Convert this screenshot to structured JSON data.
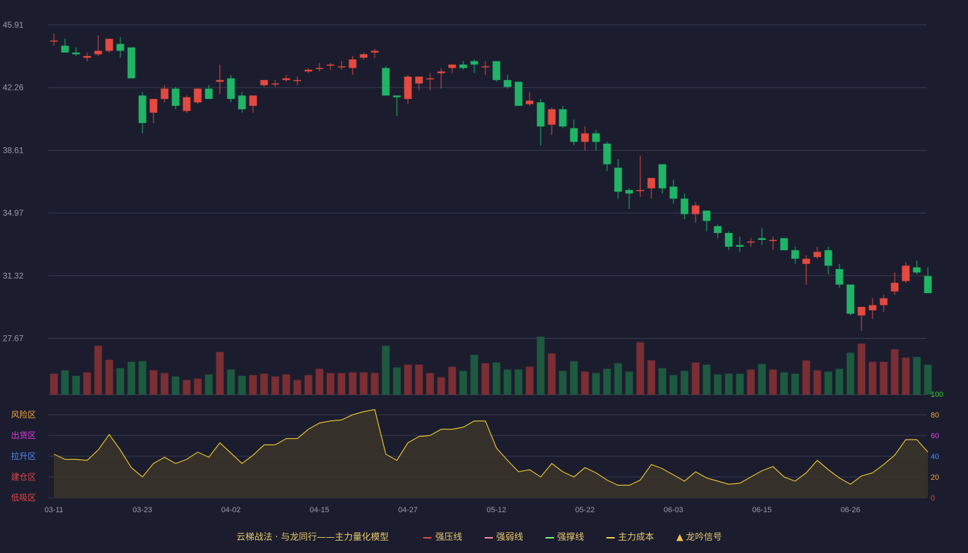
{
  "colors": {
    "background": "#1b1d2e",
    "up": "#e5493f",
    "down": "#1fb566",
    "up_vol": "#7b2e33",
    "down_vol": "#1d5a3f",
    "grid": "#3a3d52",
    "axis_text": "#9a9cab",
    "line": "#e8c32e",
    "area": "#3a3429"
  },
  "chart_data": [
    {
      "type": "candlestick",
      "title": "",
      "ylim": [
        24.02,
        45.91
      ],
      "y_ticks": [
        "45.91",
        "42.26",
        "38.61",
        "34.97",
        "31.32",
        "27.67"
      ],
      "x_ticks": [
        {
          "label": "03-11",
          "index": 0
        },
        {
          "label": "03-23",
          "index": 8
        },
        {
          "label": "04-02",
          "index": 16
        },
        {
          "label": "04-15",
          "index": 24
        },
        {
          "label": "04-27",
          "index": 32
        },
        {
          "label": "05-12",
          "index": 40
        },
        {
          "label": "05-22",
          "index": 48
        },
        {
          "label": "06-03",
          "index": 56
        },
        {
          "label": "06-15",
          "index": 64
        },
        {
          "label": "06-26",
          "index": 72
        }
      ],
      "ohlc": [
        [
          45.0,
          45.0,
          45.4,
          44.7
        ],
        [
          44.7,
          44.3,
          45.1,
          44.3
        ],
        [
          44.3,
          44.2,
          44.6,
          44.1
        ],
        [
          44.0,
          44.1,
          44.3,
          43.8
        ],
        [
          44.2,
          44.4,
          45.3,
          44.1
        ],
        [
          44.4,
          45.1,
          45.1,
          44.3
        ],
        [
          44.8,
          44.4,
          45.2,
          44.0
        ],
        [
          44.6,
          42.8,
          44.6,
          42.8
        ],
        [
          41.8,
          40.2,
          42.0,
          39.6
        ],
        [
          40.8,
          41.6,
          41.6,
          40.2
        ],
        [
          41.6,
          42.2,
          42.4,
          41.4
        ],
        [
          42.2,
          41.2,
          42.3,
          41.0
        ],
        [
          40.9,
          41.7,
          41.8,
          40.8
        ],
        [
          41.4,
          42.2,
          42.2,
          41.3
        ],
        [
          42.2,
          41.6,
          42.4,
          41.6
        ],
        [
          42.6,
          42.7,
          43.6,
          41.9
        ],
        [
          42.8,
          41.6,
          43.0,
          41.4
        ],
        [
          41.8,
          41.0,
          42.0,
          40.8
        ],
        [
          41.2,
          41.8,
          41.8,
          40.8
        ],
        [
          42.4,
          42.7,
          42.7,
          42.3
        ],
        [
          42.5,
          42.5,
          42.7,
          42.3
        ],
        [
          42.7,
          42.8,
          43.0,
          42.6
        ],
        [
          42.7,
          42.7,
          42.9,
          42.4
        ],
        [
          43.2,
          43.3,
          43.4,
          43.1
        ],
        [
          43.4,
          43.4,
          43.7,
          43.2
        ],
        [
          43.6,
          43.6,
          43.7,
          43.3
        ],
        [
          43.5,
          43.5,
          43.8,
          43.3
        ],
        [
          43.4,
          43.9,
          44.1,
          43.0
        ],
        [
          44.0,
          44.2,
          44.3,
          43.9
        ],
        [
          44.3,
          44.4,
          44.5,
          44.0
        ],
        [
          43.4,
          41.8,
          43.5,
          41.8
        ],
        [
          41.8,
          41.7,
          41.8,
          40.6
        ],
        [
          41.6,
          42.9,
          43.0,
          41.3
        ],
        [
          42.5,
          42.9,
          42.9,
          42.1
        ],
        [
          42.8,
          42.8,
          43.1,
          42.1
        ],
        [
          43.1,
          43.2,
          43.4,
          42.2
        ],
        [
          43.4,
          43.6,
          43.6,
          43.1
        ],
        [
          43.6,
          43.4,
          43.8,
          43.3
        ],
        [
          43.8,
          43.6,
          43.9,
          43.1
        ],
        [
          43.5,
          43.5,
          43.8,
          43.0
        ],
        [
          43.8,
          42.7,
          43.8,
          42.6
        ],
        [
          42.7,
          42.3,
          43.0,
          42.2
        ],
        [
          42.6,
          41.2,
          42.6,
          41.2
        ],
        [
          41.3,
          41.5,
          42.0,
          41.2
        ],
        [
          41.4,
          40.0,
          41.6,
          38.9
        ],
        [
          40.1,
          41.0,
          41.1,
          39.5
        ],
        [
          41.0,
          40.0,
          41.2,
          39.9
        ],
        [
          39.9,
          39.1,
          40.4,
          38.9
        ],
        [
          39.1,
          39.6,
          40.0,
          38.6
        ],
        [
          39.6,
          39.1,
          39.8,
          38.6
        ],
        [
          39.0,
          37.8,
          39.1,
          37.4
        ],
        [
          37.6,
          36.2,
          38.1,
          35.8
        ],
        [
          36.3,
          36.1,
          36.4,
          35.2
        ],
        [
          36.3,
          36.3,
          38.3,
          35.9
        ],
        [
          36.4,
          37.0,
          37.0,
          35.8
        ],
        [
          37.8,
          36.4,
          37.8,
          36.1
        ],
        [
          36.5,
          35.8,
          36.9,
          35.5
        ],
        [
          35.8,
          34.9,
          36.1,
          34.6
        ],
        [
          34.9,
          35.4,
          35.6,
          34.4
        ],
        [
          35.1,
          34.5,
          35.1,
          33.9
        ],
        [
          34.2,
          33.8,
          34.3,
          33.5
        ],
        [
          33.8,
          33.0,
          33.9,
          32.8
        ],
        [
          33.1,
          33.0,
          33.6,
          32.7
        ],
        [
          33.3,
          33.3,
          33.5,
          33.0
        ],
        [
          33.5,
          33.4,
          34.1,
          33.1
        ],
        [
          33.4,
          33.4,
          33.6,
          32.8
        ],
        [
          33.5,
          32.8,
          33.5,
          32.8
        ],
        [
          32.8,
          32.3,
          33.0,
          32.0
        ],
        [
          32.0,
          32.3,
          32.5,
          30.8
        ],
        [
          32.4,
          32.7,
          33.0,
          32.3
        ],
        [
          32.8,
          31.9,
          33.0,
          31.4
        ],
        [
          31.7,
          30.8,
          32.0,
          30.6
        ],
        [
          30.8,
          29.1,
          30.8,
          29.0
        ],
        [
          29.0,
          29.5,
          29.5,
          28.1
        ],
        [
          29.3,
          29.6,
          30.0,
          28.8
        ],
        [
          29.6,
          30.0,
          30.2,
          29.2
        ],
        [
          30.4,
          30.9,
          31.5,
          30.2
        ],
        [
          31.0,
          31.9,
          32.1,
          30.9
        ],
        [
          31.8,
          31.5,
          32.2,
          31.4
        ],
        [
          31.3,
          30.3,
          31.8,
          30.3
        ]
      ]
    },
    {
      "type": "bar",
      "title": "",
      "volume": [
        30,
        35,
        27,
        32,
        70,
        50,
        38,
        47,
        48,
        35,
        31,
        26,
        21,
        23,
        29,
        61,
        36,
        27,
        28,
        30,
        26,
        29,
        21,
        28,
        37,
        31,
        31,
        32,
        32,
        31,
        70,
        39,
        43,
        43,
        31,
        25,
        40,
        34,
        57,
        45,
        46,
        36,
        36,
        40,
        83,
        59,
        34,
        48,
        33,
        31,
        37,
        45,
        33,
        75,
        49,
        38,
        28,
        34,
        46,
        43,
        29,
        30,
        30,
        36,
        44,
        36,
        32,
        30,
        49,
        35,
        33,
        37,
        60,
        73,
        47,
        47,
        65,
        53,
        54,
        43
      ]
    },
    {
      "type": "area",
      "title": "",
      "ylim": [
        0,
        100
      ],
      "y_ticks": [
        "100",
        "80",
        "60",
        "40",
        "20",
        "0"
      ],
      "zones": [
        "风险区",
        "出货区",
        "拉升区",
        "建仓区",
        "低吸区"
      ],
      "values": [
        42,
        37,
        37,
        36,
        46,
        61,
        46,
        29,
        20,
        33,
        39,
        33,
        37,
        44,
        39,
        53,
        43,
        33,
        41,
        51,
        51,
        57,
        57,
        66,
        72,
        74,
        75,
        80,
        83,
        85,
        42,
        36,
        53,
        59,
        60,
        66,
        66,
        68,
        74,
        74,
        48,
        36,
        25,
        27,
        20,
        33,
        25,
        20,
        29,
        24,
        17,
        12,
        12,
        17,
        32,
        28,
        22,
        16,
        25,
        19,
        16,
        13,
        14,
        20,
        26,
        30,
        20,
        16,
        24,
        36,
        27,
        19,
        13,
        21,
        24,
        32,
        41,
        56,
        56,
        44
      ]
    }
  ],
  "legend": {
    "title": "云梯战法 · 与龙同行——主力量化模型",
    "items": [
      {
        "label": "强压线",
        "color": "#e5493f",
        "style": "solid"
      },
      {
        "label": "强弱线",
        "color": "#ff8fa0",
        "style": "dash"
      },
      {
        "label": "强撑线",
        "color": "#7cff7c",
        "style": "solid"
      },
      {
        "label": "主力成本",
        "color": "#f2d24a",
        "style": "dash"
      },
      {
        "label": "龙吟信号",
        "color": "#f2c24a",
        "style": "triangle",
        "glyph": "▲"
      }
    ]
  },
  "zone_colors": [
    "#f2a43a",
    "#e040e0",
    "#4f8bff",
    "#e24545",
    "#e24545"
  ],
  "right_tick_colors": [
    "#35d335",
    "#f2a43a",
    "#e040e0",
    "#4f8bff",
    "#f2a43a",
    "#e24545"
  ]
}
